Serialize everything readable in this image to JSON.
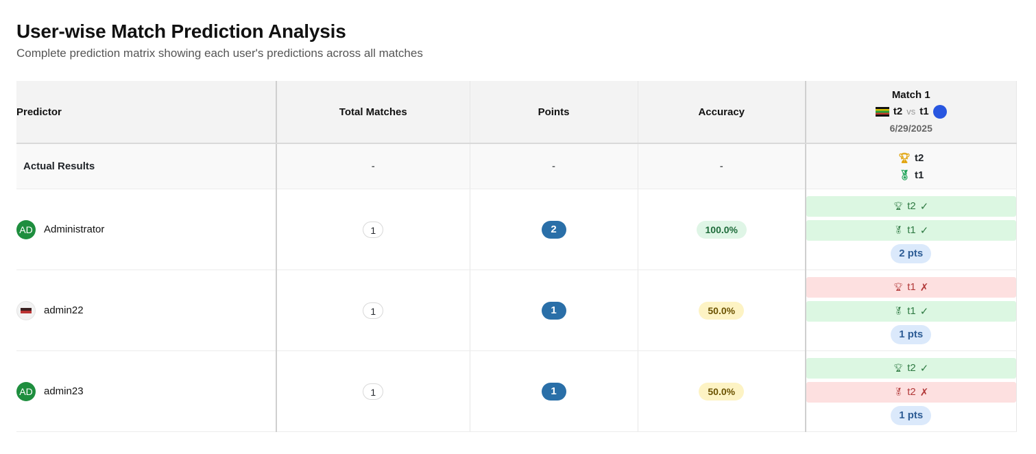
{
  "page": {
    "title": "User-wise Match Prediction Analysis",
    "subtitle": "Complete prediction matrix showing each user's predictions across all matches"
  },
  "table": {
    "headers": {
      "predictor": "Predictor",
      "total_matches": "Total Matches",
      "points": "Points",
      "accuracy": "Accuracy"
    },
    "match": {
      "title": "Match 1",
      "team_a": "t2",
      "vs": "vs",
      "team_b": "t1",
      "date": "6/29/2025"
    },
    "actual": {
      "label": "Actual Results",
      "total_matches": "-",
      "points": "-",
      "accuracy": "-",
      "winner": "t2",
      "medal": "t1"
    },
    "rows": [
      {
        "avatar": "AD",
        "avatar_color": "#1e8e3e",
        "name": "Administrator",
        "total_matches": "1",
        "points": "2",
        "accuracy": "100.0%",
        "winner_pred": "t2",
        "winner_mark": "✓",
        "winner_correct": true,
        "medal_pred": "t1",
        "medal_mark": "✓",
        "medal_correct": true,
        "pts": "2 pts"
      },
      {
        "avatar": "",
        "name": "admin22",
        "total_matches": "1",
        "points": "1",
        "accuracy": "50.0%",
        "winner_pred": "t1",
        "winner_mark": "✗",
        "winner_correct": false,
        "medal_pred": "t1",
        "medal_mark": "✓",
        "medal_correct": true,
        "pts": "1 pts"
      },
      {
        "avatar": "AD",
        "avatar_color": "#1e8e3e",
        "name": "admin23",
        "total_matches": "1",
        "points": "1",
        "accuracy": "50.0%",
        "winner_pred": "t2",
        "winner_mark": "✓",
        "winner_correct": true,
        "medal_pred": "t2",
        "medal_mark": "✗",
        "medal_correct": false,
        "pts": "1 pts"
      }
    ]
  },
  "colors": {
    "accuracy_high": "#dff5e6",
    "accuracy_mid": "#fdf3c4",
    "points_badge": "#2a6fa8",
    "correct": "#dcf7e2",
    "incorrect": "#fde0e0"
  },
  "icons": {
    "winner": "trophy-icon",
    "medal": "medal-icon",
    "team_a_logo": "flag-icon",
    "team_b_logo": "team-logo-icon"
  }
}
